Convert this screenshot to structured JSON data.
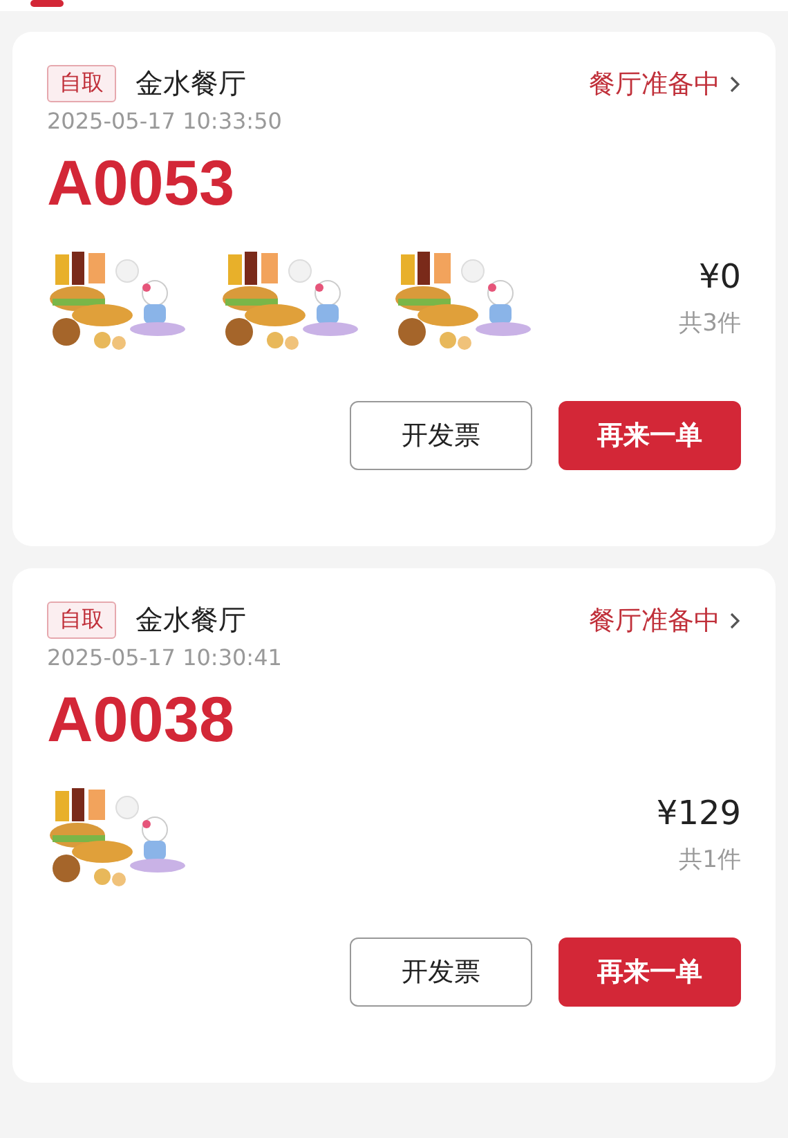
{
  "orders": [
    {
      "badge": "自取",
      "restaurant": "金水餐厅",
      "status": "餐厅准备中",
      "time": "2025-05-17 10:33:50",
      "order_number": "A0053",
      "items": [
        {
          "kind": "picture"
        },
        {
          "kind": "picture"
        },
        {
          "kind": "picture"
        }
      ],
      "price": "¥0",
      "count": "共3件",
      "buttons": [
        {
          "label": "开发票",
          "kind": "outline"
        },
        {
          "label": "再来一单",
          "kind": "primary"
        }
      ]
    },
    {
      "badge": "自取",
      "restaurant": "金水餐厅",
      "status": "餐厅准备中",
      "time": "2025-05-17 10:30:41",
      "order_number": "A0038",
      "items": [
        {
          "kind": "picture"
        }
      ],
      "price": "¥129",
      "count": "共1件",
      "buttons": [
        {
          "label": "开发票",
          "kind": "outline"
        },
        {
          "label": "再来一单",
          "kind": "primary"
        }
      ]
    }
  ]
}
